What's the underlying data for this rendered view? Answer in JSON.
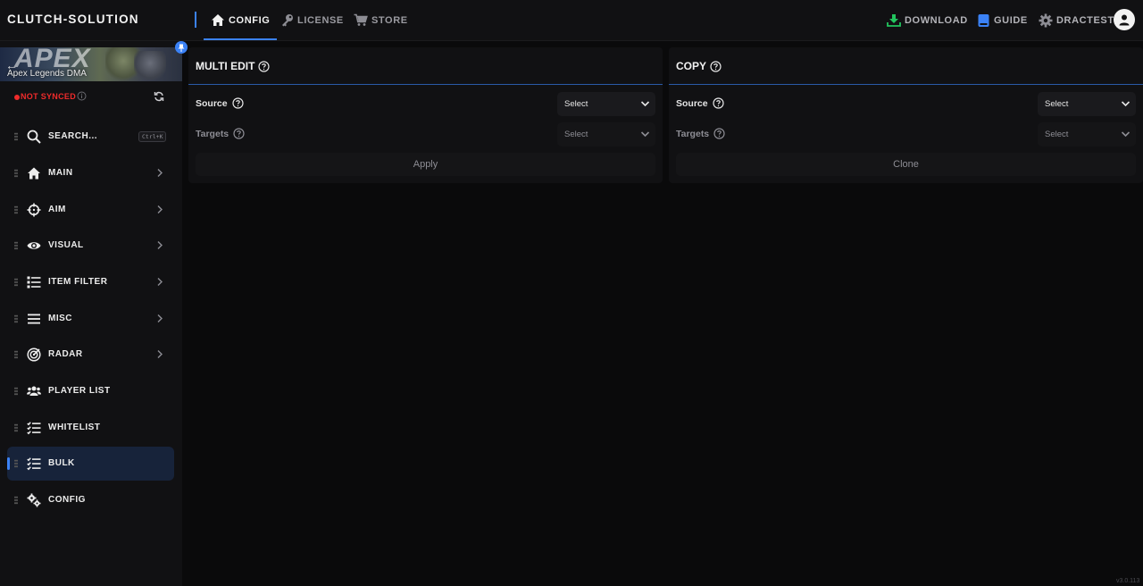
{
  "brand": "CLUTCH-SOLUTION",
  "nav": {
    "tabs": [
      {
        "label": "CONFIG",
        "icon": "home-icon",
        "active": true
      },
      {
        "label": "LICENSE",
        "icon": "key-icon",
        "active": false
      },
      {
        "label": "STORE",
        "icon": "cart-icon",
        "active": false
      }
    ],
    "right": {
      "download": "DOWNLOAD",
      "guide": "GUIDE",
      "user": "DRACTEST"
    }
  },
  "sidebar": {
    "game_name": "Apex Legends DMA",
    "banner_text": "APEX",
    "sync_status": "NOT SYNCED",
    "search": {
      "label": "SEARCH...",
      "shortcut": "Ctrl+K"
    },
    "items": [
      {
        "label": "MAIN",
        "icon": "home-icon",
        "has_chevron": true
      },
      {
        "label": "AIM",
        "icon": "crosshair-icon",
        "has_chevron": true
      },
      {
        "label": "VISUAL",
        "icon": "eye-icon",
        "has_chevron": true
      },
      {
        "label": "ITEM FILTER",
        "icon": "list-icon",
        "has_chevron": true
      },
      {
        "label": "MISC",
        "icon": "menu-icon",
        "has_chevron": true
      },
      {
        "label": "RADAR",
        "icon": "radar-icon",
        "has_chevron": true
      },
      {
        "label": "PLAYER LIST",
        "icon": "users-icon",
        "has_chevron": false
      },
      {
        "label": "WHITELIST",
        "icon": "checklist-icon",
        "has_chevron": false
      },
      {
        "label": "BULK",
        "icon": "checklist-icon",
        "has_chevron": false,
        "active": true
      },
      {
        "label": "CONFIG",
        "icon": "gears-icon",
        "has_chevron": false
      }
    ]
  },
  "multi_edit": {
    "title": "MULTI EDIT",
    "source_label": "Source",
    "source_value": "Select",
    "targets_label": "Targets",
    "targets_value": "Select",
    "action": "Apply"
  },
  "copy": {
    "title": "COPY",
    "source_label": "Source",
    "source_value": "Select",
    "targets_label": "Targets",
    "targets_value": "Select",
    "action": "Clone"
  },
  "version": "v3.0.113",
  "colors": {
    "accent": "#3b82f6",
    "danger": "#ef2b2b",
    "download": "#22c55e"
  }
}
